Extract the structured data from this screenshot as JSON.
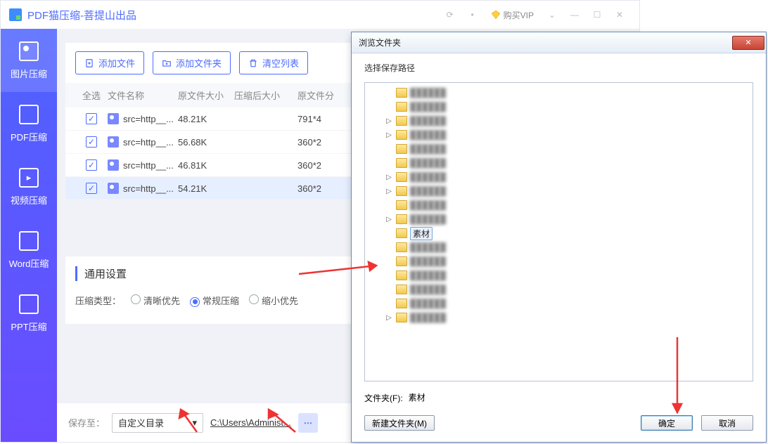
{
  "app": {
    "title": "PDF猫压缩-菩提山出品",
    "vip_label": "购买VIP"
  },
  "sidebar": {
    "items": [
      {
        "label": "图片压缩"
      },
      {
        "label": "PDF压缩"
      },
      {
        "label": "视频压缩"
      },
      {
        "label": "Word压缩"
      },
      {
        "label": "PPT压缩"
      }
    ]
  },
  "toolbar": {
    "add_file": "添加文件",
    "add_folder": "添加文件夹",
    "clear_list": "清空列表"
  },
  "table": {
    "head": {
      "select_all": "全选",
      "name": "文件名称",
      "orig": "原文件大小",
      "comp": "压缩后大小",
      "dim": "原文件分"
    },
    "rows": [
      {
        "name": "src=http__...",
        "orig": "48.21K",
        "dim": "791*4"
      },
      {
        "name": "src=http__...",
        "orig": "56.68K",
        "dim": "360*2"
      },
      {
        "name": "src=http__...",
        "orig": "46.81K",
        "dim": "360*2"
      },
      {
        "name": "src=http__...",
        "orig": "54.21K",
        "dim": "360*2"
      }
    ],
    "selected_row_index": 3
  },
  "settings": {
    "heading": "通用设置",
    "type_label": "压缩类型：",
    "options": [
      "清晰优先",
      "常规压缩",
      "缩小优先"
    ],
    "selected": 1
  },
  "bottom": {
    "save_to": "保存至：",
    "select_value": "自定义目录",
    "path": "C:\\Users\\Administ..."
  },
  "dialog": {
    "title": "浏览文件夹",
    "subtitle": "选择保存路径",
    "folders": [
      {
        "indent": 1,
        "exp": "",
        "blur": true
      },
      {
        "indent": 1,
        "exp": "",
        "blur": true
      },
      {
        "indent": 1,
        "exp": "▷",
        "blur": true
      },
      {
        "indent": 1,
        "exp": "▷",
        "blur": true
      },
      {
        "indent": 1,
        "exp": "",
        "blur": true
      },
      {
        "indent": 1,
        "exp": "",
        "blur": true
      },
      {
        "indent": 1,
        "exp": "▷",
        "blur": true
      },
      {
        "indent": 1,
        "exp": "▷",
        "blur": true
      },
      {
        "indent": 1,
        "exp": "",
        "blur": true
      },
      {
        "indent": 1,
        "exp": "▷",
        "blur": true
      },
      {
        "indent": 1,
        "exp": "",
        "label": "素材",
        "selected": true
      },
      {
        "indent": 1,
        "exp": "",
        "blur": true
      },
      {
        "indent": 1,
        "exp": "",
        "blur": true
      },
      {
        "indent": 1,
        "exp": "",
        "blur": true
      },
      {
        "indent": 1,
        "exp": "",
        "blur": true
      },
      {
        "indent": 1,
        "exp": "",
        "blur": true
      },
      {
        "indent": 1,
        "exp": "▷",
        "blur": true
      }
    ],
    "field_label": "文件夹(F):",
    "field_value": "素材",
    "new_folder": "新建文件夹(M)",
    "ok": "确定",
    "cancel": "取消"
  }
}
